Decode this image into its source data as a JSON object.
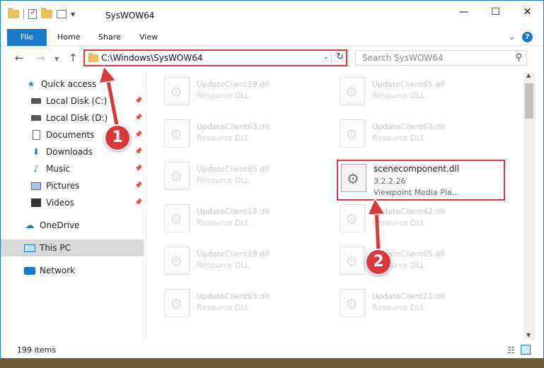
{
  "window": {
    "title": "SysWOW64",
    "controls": {
      "minimize": "—",
      "maximize": "☐",
      "close": "✕"
    }
  },
  "ribbon": {
    "tabs": [
      "File",
      "Home",
      "Share",
      "View"
    ],
    "expand_icon": "chevron-down-icon",
    "help_label": "?"
  },
  "navigation": {
    "address": "C:\\Windows\\SysWOW64",
    "search_placeholder": "Search SysWOW64"
  },
  "sidebar": {
    "items": [
      {
        "label": "Quick access",
        "icon": "star-icon"
      },
      {
        "label": "Local Disk (C:)",
        "icon": "drive-icon",
        "pinned": true
      },
      {
        "label": "Local Disk (D:)",
        "icon": "drive-icon",
        "pinned": true
      },
      {
        "label": "Documents",
        "icon": "documents-icon",
        "pinned": true
      },
      {
        "label": "Downloads",
        "icon": "download-icon",
        "pinned": true
      },
      {
        "label": "Music",
        "icon": "music-icon",
        "pinned": true
      },
      {
        "label": "Pictures",
        "icon": "pictures-icon",
        "pinned": true
      },
      {
        "label": "Videos",
        "icon": "videos-icon",
        "pinned": true
      },
      {
        "label": "OneDrive",
        "icon": "cloud-icon"
      },
      {
        "label": "This PC",
        "icon": "computer-icon",
        "selected": true
      },
      {
        "label": "Network",
        "icon": "network-icon"
      }
    ]
  },
  "files": {
    "left": [
      {
        "name": "UpdateClient19.dll",
        "type": "Resource DLL"
      },
      {
        "name": "UpdateClient63.dll",
        "type": "Resource DLL"
      },
      {
        "name": "UpdateClient65.dll",
        "type": "Resource DLL"
      },
      {
        "name": "UpdateClient19.dll",
        "type": "Resource DLL"
      },
      {
        "name": "UpdateClient19.dll",
        "type": "Resource DLL"
      },
      {
        "name": "UpdateClient65.dll",
        "type": "Resource DLL"
      }
    ],
    "right": [
      {
        "name": "UpdateClient65.dll",
        "type": "Resource DLL"
      },
      {
        "name": "UpdateClient63.dll",
        "type": "Resource DLL"
      },
      {
        "name": "scenecomponent.dll",
        "type": "3.2.2.26",
        "extra": "Viewpoint Media Pla...",
        "highlighted": true
      },
      {
        "name": "UpdateClient42.dll",
        "type": "Resource DLL"
      },
      {
        "name": "UpdateClient65.dll",
        "type": "Resource DLL"
      },
      {
        "name": "UpdateClient21.dll",
        "type": "Resource DLL"
      }
    ]
  },
  "status": {
    "item_count": "199 items"
  },
  "callouts": [
    {
      "number": "1"
    },
    {
      "number": "2"
    }
  ],
  "colors": {
    "accent": "#1979ca",
    "highlight": "#d9383c"
  }
}
